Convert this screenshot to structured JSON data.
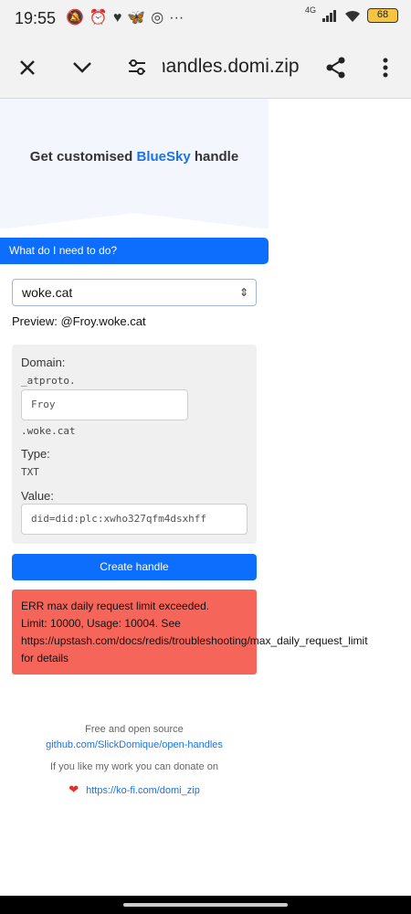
{
  "status_bar": {
    "time": "19:55",
    "network": "4G",
    "battery": "68"
  },
  "browser": {
    "url": "handles.domi.zip"
  },
  "hero": {
    "prefix": "Get customised ",
    "brand": "BlueSky",
    "suffix": " handle"
  },
  "help_button": "What do I need to do?",
  "domain_select": {
    "value": "woke.cat"
  },
  "preview": "Preview: @Froy.woke.cat",
  "record": {
    "domain_label": "Domain:",
    "domain_prefix": "_atproto.",
    "handle_value": "Froy",
    "domain_suffix": ".woke.cat",
    "type_label": "Type:",
    "type_value": "TXT",
    "value_label": "Value:",
    "value_value": "did=did:plc:xwho327qfm4dsxhff"
  },
  "create_button": "Create handle",
  "error": "ERR max daily request limit exceeded.\nLimit: 10000, Usage: 10004. See\nhttps://upstash.com/docs/redis/troubleshooting/max_daily_request_limit\nfor details",
  "footer": {
    "line1": "Free and open source",
    "repo_link": "github.com/SlickDomique/open-handles",
    "donate_text": "If you like my work you can donate on",
    "donate_link": "https://ko-fi.com/domi_zip"
  }
}
